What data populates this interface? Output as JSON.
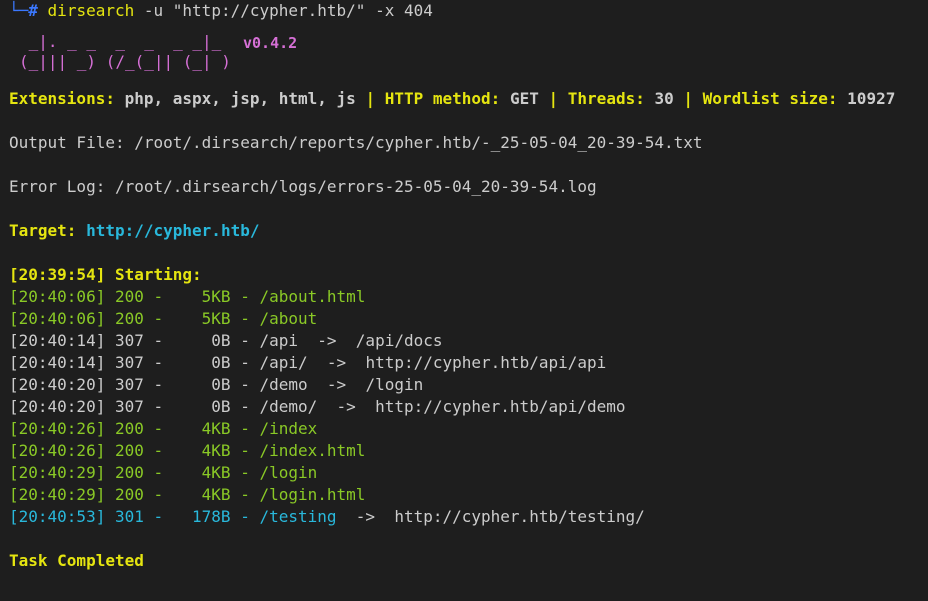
{
  "prompt": {
    "corner": "└─",
    "hash": "#",
    "command": "dirsearch",
    "args": " -u \"http://cypher.htb/\" -x 404"
  },
  "banner": {
    "ascii_line1": " _|. _ _  _  _  _ _|_",
    "ascii_line2": "(_||| _) (/_(_|| (_| )",
    "version": "v0.4.2"
  },
  "config": {
    "ext_label": "Extensions:",
    "ext_value": "php, aspx, jsp, html, js",
    "sep": "|",
    "method_label": "HTTP method:",
    "method_value": "GET",
    "threads_label": "Threads:",
    "threads_value": "30",
    "wordlist_label": "Wordlist size:",
    "wordlist_value": "10927"
  },
  "output_file": "Output File: /root/.dirsearch/reports/cypher.htb/-_25-05-04_20-39-54.txt",
  "error_log": "Error Log: /root/.dirsearch/logs/errors-25-05-04_20-39-54.log",
  "target": {
    "label": "Target:",
    "url": "http://cypher.htb/"
  },
  "starting": {
    "time": "[20:39:54]",
    "label": "Starting:"
  },
  "results": [
    {
      "time": "[20:40:06]",
      "status": "200",
      "size": "5KB",
      "path": "/about.html",
      "redirect": ""
    },
    {
      "time": "[20:40:06]",
      "status": "200",
      "size": "5KB",
      "path": "/about",
      "redirect": ""
    },
    {
      "time": "[20:40:14]",
      "status": "307",
      "size": "0B",
      "path": "/api",
      "redirect": "/api/docs"
    },
    {
      "time": "[20:40:14]",
      "status": "307",
      "size": "0B",
      "path": "/api/",
      "redirect": "http://cypher.htb/api/api"
    },
    {
      "time": "[20:40:20]",
      "status": "307",
      "size": "0B",
      "path": "/demo",
      "redirect": "/login"
    },
    {
      "time": "[20:40:20]",
      "status": "307",
      "size": "0B",
      "path": "/demo/",
      "redirect": "http://cypher.htb/api/demo"
    },
    {
      "time": "[20:40:26]",
      "status": "200",
      "size": "4KB",
      "path": "/index",
      "redirect": ""
    },
    {
      "time": "[20:40:26]",
      "status": "200",
      "size": "4KB",
      "path": "/index.html",
      "redirect": ""
    },
    {
      "time": "[20:40:29]",
      "status": "200",
      "size": "4KB",
      "path": "/login",
      "redirect": ""
    },
    {
      "time": "[20:40:29]",
      "status": "200",
      "size": "4KB",
      "path": "/login.html",
      "redirect": ""
    },
    {
      "time": "[20:40:53]",
      "status": "301",
      "size": "178B",
      "path": "/testing",
      "redirect": "http://cypher.htb/testing/"
    }
  ],
  "completed": "Task Completed"
}
